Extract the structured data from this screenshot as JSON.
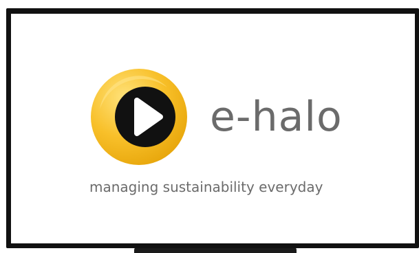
{
  "brand": {
    "name": "e-halo",
    "tagline": "managing sustainability everyday",
    "logo_icon": "play-circle-logo-icon"
  },
  "colors": {
    "screen_background": "#ffffff",
    "frame": "#111111",
    "logo_ring": "#f6b81a",
    "logo_ring_highlight": "#ffd95a",
    "logo_inner": "#111111",
    "logo_play": "#ffffff",
    "text": "#6b6b6b"
  }
}
